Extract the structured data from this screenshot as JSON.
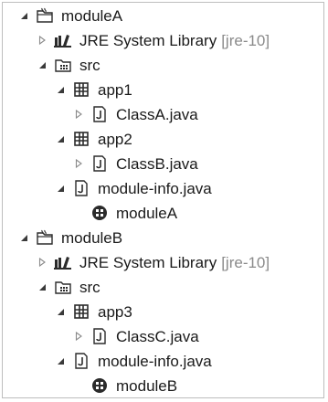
{
  "tree": [
    {
      "label": "moduleA",
      "decoration": "",
      "icon": "java-project-icon",
      "expanded": true,
      "depth": 0
    },
    {
      "label": "JRE System Library",
      "decoration": "[jre-10]",
      "icon": "library-icon",
      "expanded": false,
      "depth": 1
    },
    {
      "label": "src",
      "decoration": "",
      "icon": "source-folder-icon",
      "expanded": true,
      "depth": 1
    },
    {
      "label": "app1",
      "decoration": "",
      "icon": "package-icon",
      "expanded": true,
      "depth": 2
    },
    {
      "label": "ClassA.java",
      "decoration": "",
      "icon": "java-file-icon",
      "expanded": false,
      "depth": 3
    },
    {
      "label": "app2",
      "decoration": "",
      "icon": "package-icon",
      "expanded": true,
      "depth": 2
    },
    {
      "label": "ClassB.java",
      "decoration": "",
      "icon": "java-file-icon",
      "expanded": false,
      "depth": 3
    },
    {
      "label": "module-info.java",
      "decoration": "",
      "icon": "java-file-icon",
      "expanded": true,
      "depth": 2
    },
    {
      "label": "moduleA",
      "decoration": "",
      "icon": "module-icon",
      "expanded": null,
      "depth": 3
    },
    {
      "label": "moduleB",
      "decoration": "",
      "icon": "java-project-icon",
      "expanded": true,
      "depth": 0
    },
    {
      "label": "JRE System Library",
      "decoration": "[jre-10]",
      "icon": "library-icon",
      "expanded": false,
      "depth": 1
    },
    {
      "label": "src",
      "decoration": "",
      "icon": "source-folder-icon",
      "expanded": true,
      "depth": 1
    },
    {
      "label": "app3",
      "decoration": "",
      "icon": "package-icon",
      "expanded": true,
      "depth": 2
    },
    {
      "label": "ClassC.java",
      "decoration": "",
      "icon": "java-file-icon",
      "expanded": false,
      "depth": 3
    },
    {
      "label": "module-info.java",
      "decoration": "",
      "icon": "java-file-icon",
      "expanded": true,
      "depth": 2
    },
    {
      "label": "moduleB",
      "decoration": "",
      "icon": "module-icon",
      "expanded": null,
      "depth": 3
    }
  ]
}
